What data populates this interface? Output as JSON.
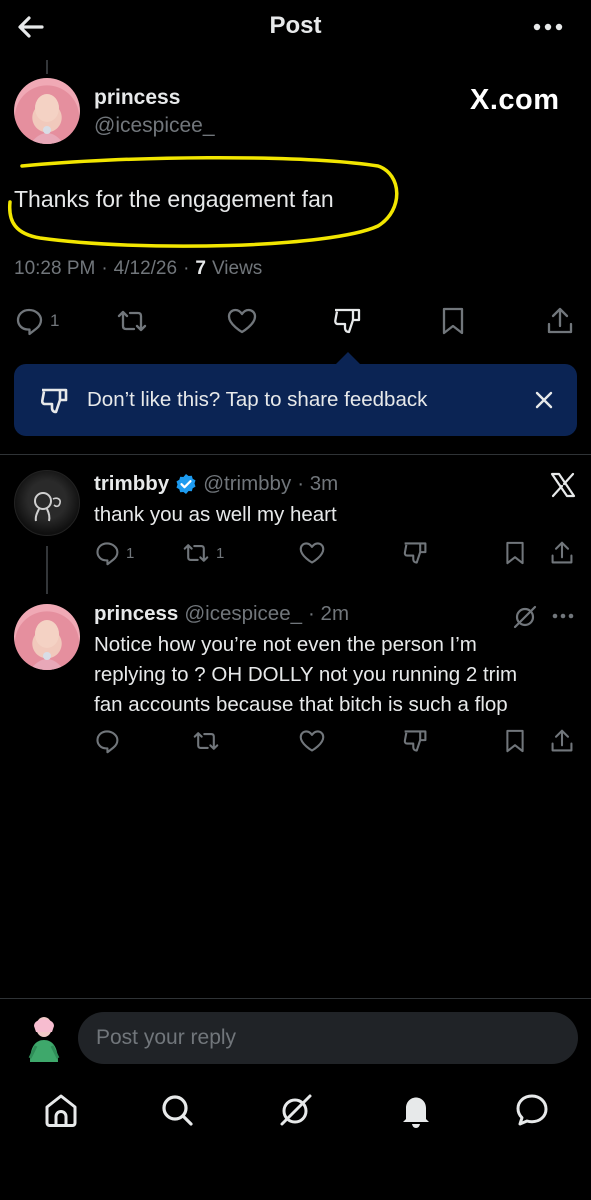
{
  "header": {
    "title": "Post"
  },
  "main_post": {
    "author_name": "princess",
    "author_handle": "@icespicee_",
    "watermark": "X.com",
    "text": "Thanks for the engagement fan",
    "time": "10:28 PM",
    "date": "4/12/26",
    "sep": "·",
    "views_count": "7",
    "views_label": "Views",
    "reply_count": "1"
  },
  "feedback_banner": {
    "text": "Don’t like this? Tap to share feedback"
  },
  "replies": [
    {
      "name": "trimbby",
      "handle": "@trimbby",
      "time": "· 3m",
      "text": "thank you as well my heart",
      "reply_count": "1",
      "repost_count": "1",
      "verified_color": "#1d9bf0"
    },
    {
      "name": "princess",
      "handle": "@icespicee_",
      "time": "· 2m",
      "text_lines": [
        "Notice how you’re not even the person I’m",
        "replying to ? OH DOLLY not you running 2 trim",
        "fan accounts because that bitch is such a flop"
      ]
    }
  ],
  "composer": {
    "placeholder": "Post your reply"
  },
  "colors": {
    "accent": "#1d9bf0",
    "banner": "#0b2454",
    "highlight": "#f2e600",
    "muted": "#71767b"
  },
  "bottom_nav": [
    "home-icon",
    "search-icon",
    "grok-icon",
    "notifications-icon",
    "messages-icon"
  ]
}
